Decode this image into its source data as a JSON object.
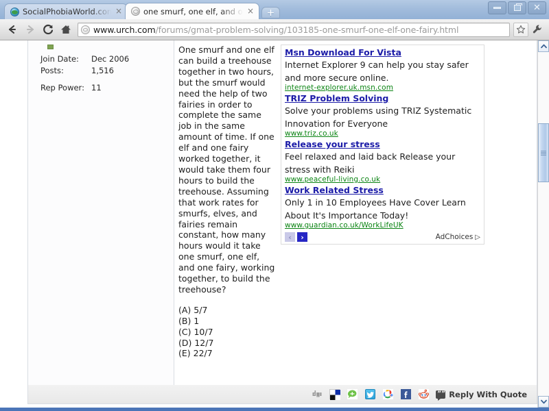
{
  "browser": {
    "tabs": [
      {
        "title": "SocialPhobiaWorld.com - Reply",
        "favicon": "globe-icon",
        "active": false,
        "close_label": "×"
      },
      {
        "title": "one smurf, one elf, and one fa",
        "favicon": "page-globe-icon",
        "active": true,
        "close_label": "×"
      }
    ],
    "new_tab_label": "+",
    "window_controls": {
      "minimize": "minimize",
      "restore": "restore",
      "close": "close"
    },
    "nav": {
      "back": "back-arrow",
      "forward": "forward-arrow",
      "reload": "reload",
      "home": "home",
      "bookmark": "star",
      "menu": "wrench"
    },
    "omnibox": {
      "host": "www.urch.com",
      "path": "/forums/gmat-problem-solving/103185-one-smurf-one-elf-one-fairy.html"
    }
  },
  "post": {
    "online_status": "online",
    "user_stats": [
      {
        "label": "Join Date:",
        "value": "Dec 2006"
      },
      {
        "label": "Posts:",
        "value": "1,516"
      },
      {
        "label": "Rep Power:",
        "value": "11"
      }
    ],
    "question": "One smurf and one elf can build a treehouse together in two hours, but the smurf would need the help of two fairies in order to complete the same job in the same amount of time. If one elf and one fairy worked together, it would take them four hours to build the treehouse. Assuming that work rates for smurfs, elves, and fairies remain constant, how many hours would it take one smurf, one elf, and one fairy, working together, to build the treehouse?",
    "choices": [
      "(A) 5/7",
      "(B) 1",
      "(C) 10/7",
      "(D) 12/7",
      "(E) 22/7"
    ]
  },
  "ads": {
    "items": [
      {
        "title": "Msn Download For Vista",
        "description": "Internet Explorer 9 can help you stay safer and more secure online.",
        "url": "internet-explorer.uk.msn.com"
      },
      {
        "title": "TRIZ Problem Solving",
        "description": "Solve your problems using TRIZ Systematic Innovation for Everyone",
        "url": "www.triz.co.uk"
      },
      {
        "title": "Release your stress",
        "description": "Feel relaxed and laid back Release your stress with Reiki",
        "url": "www.peaceful-living.co.uk"
      },
      {
        "title": "Work Related Stress",
        "description": "Only 1 in 10 Employees Have Cover Learn About It's Importance Today!",
        "url": "www.guardian.co.uk/WorkLifeUK"
      }
    ],
    "prev_label": "‹",
    "next_label": "›",
    "adchoices_label": "AdChoices",
    "adchoices_marker": "▷"
  },
  "footer": {
    "share_icons": [
      "digg-icon",
      "delicious-icon",
      "technorati-icon",
      "twitter-icon",
      "google-icon",
      "facebook-icon",
      "reddit-icon"
    ],
    "reply_with_quote": "Reply With Quote",
    "quote_glyph": "””"
  },
  "colors": {
    "ad_title": "#1c1ca8",
    "ad_url": "#0b8413",
    "chrome_blue": "#93b1d6",
    "next_arrow": "#2626c4"
  }
}
